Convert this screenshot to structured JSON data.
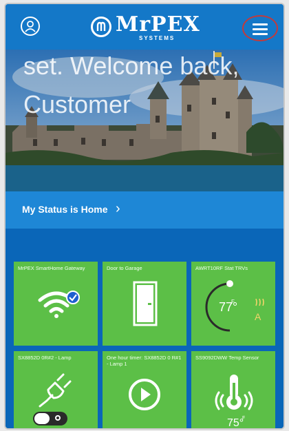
{
  "app": {
    "brand_name": "MrPEX",
    "brand_sub": "SYSTEMS",
    "welcome_text": "set. Welcome back, Customer"
  },
  "status": {
    "label": "My Status is Home",
    "chevron": "›"
  },
  "tiles": [
    {
      "label": "MrPEX SmartHome Gateway",
      "icon": "wifi-check-icon"
    },
    {
      "label": "Door to Garage",
      "icon": "door-icon"
    },
    {
      "label": "AWRT10RF Stat   TRVs",
      "icon": "thermostat-dial-icon",
      "temperature": "77°",
      "mode": "A",
      "unit": "F"
    },
    {
      "label": "SX8852D 0R#2 - Lamp",
      "icon": "plug-icon",
      "toggle": "on"
    },
    {
      "label": "One hour timer: SX8852D 0 R#1 - Lamp 1",
      "icon": "play-icon"
    },
    {
      "label": "SS9092DWW Temp Sensor",
      "icon": "thermometer-icon",
      "temperature": "75°",
      "unit": "F"
    }
  ],
  "colors": {
    "topbar": "#1478c8",
    "status_bar": "#1e87d6",
    "tile_green": "#5cbf47",
    "menu_highlight": "#c43a3a"
  }
}
